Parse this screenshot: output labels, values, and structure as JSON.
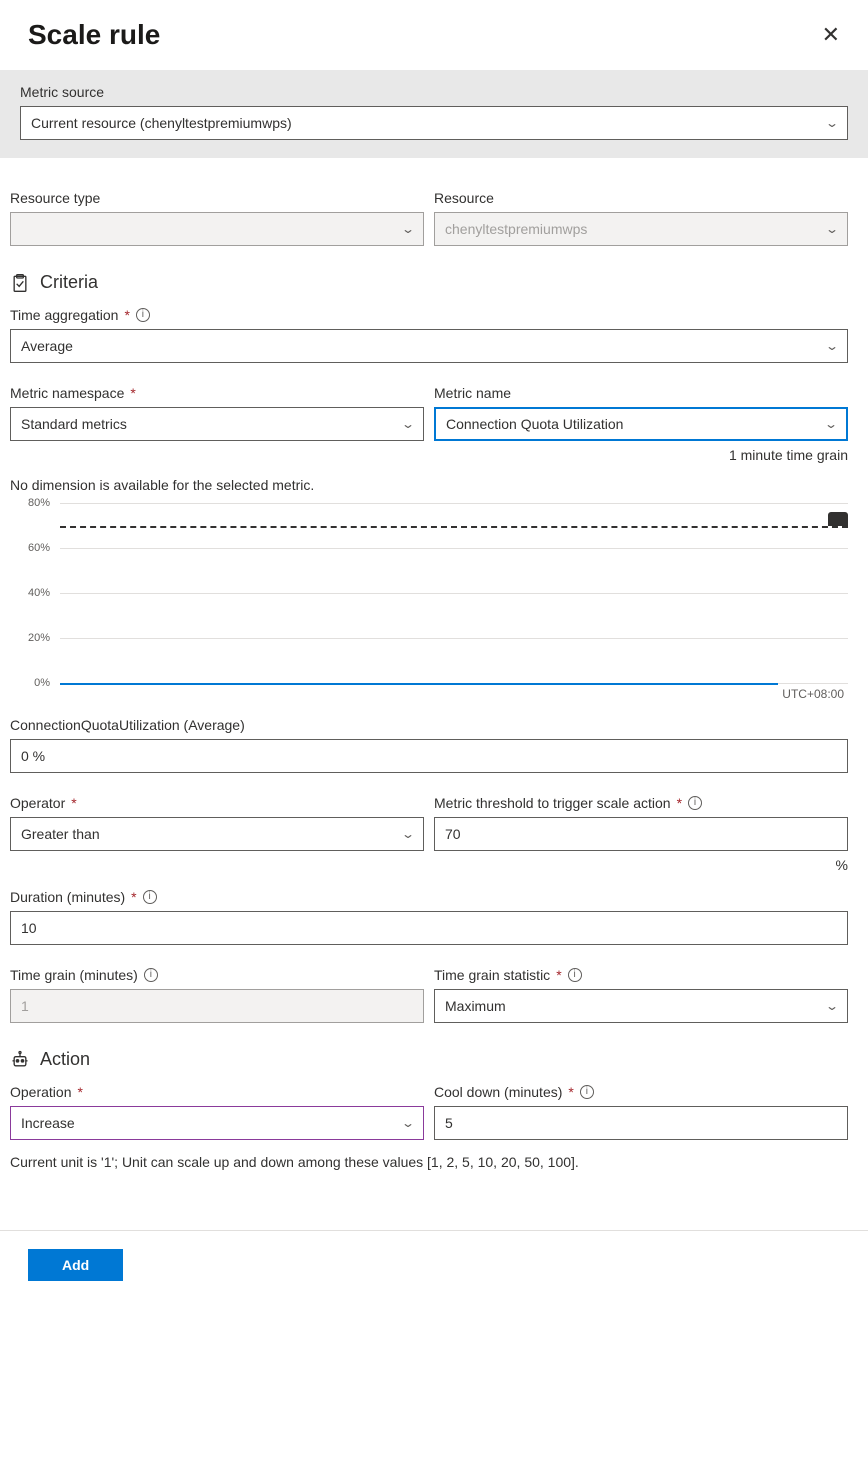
{
  "header": {
    "title": "Scale rule"
  },
  "metric_source": {
    "label": "Metric source",
    "value": "Current resource (chenyltestpremiumwps)"
  },
  "resource_type": {
    "label": "Resource type",
    "value": ""
  },
  "resource": {
    "label": "Resource",
    "value": "chenyltestpremiumwps"
  },
  "criteria": {
    "heading": "Criteria",
    "time_aggregation": {
      "label": "Time aggregation",
      "value": "Average"
    },
    "metric_namespace": {
      "label": "Metric namespace",
      "value": "Standard metrics"
    },
    "metric_name": {
      "label": "Metric name",
      "value": "Connection Quota Utilization"
    },
    "time_grain_hint": "1 minute time grain",
    "dimension_text": "No dimension is available for the selected metric.",
    "chart_tz": "UTC+08:00",
    "metric_display_label": "ConnectionQuotaUtilization (Average)",
    "metric_display_value": "0 %",
    "operator": {
      "label": "Operator",
      "value": "Greater than"
    },
    "threshold": {
      "label": "Metric threshold to trigger scale action",
      "value": "70",
      "unit": "%"
    },
    "duration": {
      "label": "Duration (minutes)",
      "value": "10"
    },
    "time_grain": {
      "label": "Time grain (minutes)",
      "value": "1"
    },
    "time_grain_stat": {
      "label": "Time grain statistic",
      "value": "Maximum"
    }
  },
  "action": {
    "heading": "Action",
    "operation": {
      "label": "Operation",
      "value": "Increase"
    },
    "cooldown": {
      "label": "Cool down (minutes)",
      "value": "5"
    },
    "note": "Current unit is '1'; Unit can scale up and down among these values [1, 2, 5, 10, 20, 50, 100]."
  },
  "footer": {
    "add": "Add"
  },
  "chart_data": {
    "type": "line",
    "title": "ConnectionQuotaUtilization (Average)",
    "ylabel": "%",
    "ylim": [
      0,
      80
    ],
    "yticks": [
      0,
      20,
      40,
      60,
      80
    ],
    "threshold": 70,
    "series": [
      {
        "name": "ConnectionQuotaUtilization",
        "values": [
          0,
          0,
          0,
          0,
          0,
          0,
          0,
          0,
          0,
          0,
          0,
          0,
          0,
          0,
          0,
          0,
          0,
          0,
          0,
          0,
          0,
          0,
          0,
          0,
          0
        ]
      }
    ],
    "timezone": "UTC+08:00"
  }
}
